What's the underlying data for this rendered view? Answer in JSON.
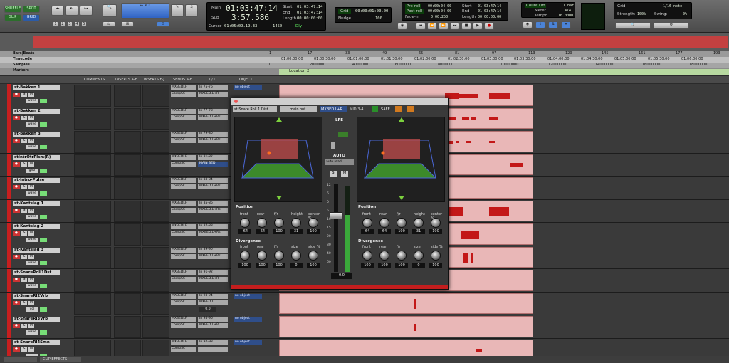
{
  "toolbar": {
    "modes": [
      "SHUFFLE",
      "SPOT",
      "SLIP",
      "GRID"
    ],
    "number_buttons": [
      "1",
      "2",
      "3",
      "4",
      "5"
    ],
    "counter": {
      "main_label": "Main",
      "main_value": "01:03:47:14",
      "sub_label": "Sub",
      "sub_value": "3:57.586",
      "start_label": "Start",
      "start_value": "01:03:47:14",
      "end_label": "End",
      "end_value": "01:03:47:14",
      "length_label": "Length",
      "length_value": "00:00:00:00",
      "cursor_label": "Cursor",
      "cursor_value": "01:05:09.19.33",
      "cursor_extra": "1450",
      "dly_label": "Dly"
    },
    "grid": {
      "grid_label": "Grid",
      "grid_value": "00:00:01:00.00",
      "nudge_label": "Nudge",
      "nudge_value": "100"
    },
    "preroll": {
      "preroll_label": "Pre-roll",
      "preroll_value": "00:00:04:00",
      "postroll_label": "Post-roll",
      "postroll_value": "00:00:04:00",
      "fadein_label": "Fade-in",
      "fadein_value": "0:00.250",
      "start_label": "Start",
      "start_value": "01:03:47:14",
      "end_label": "End",
      "end_value": "01:03:47:14",
      "length_label": "Length",
      "length_value": "00:00:00:00"
    },
    "meter": {
      "countoff": "Count Off",
      "countoff_value": "1 bar",
      "meter_label": "Meter",
      "meter_value": "4/4",
      "tempo_label": "Tempo",
      "tempo_value": "116.0000"
    },
    "grid2": {
      "grid_label": "Grid:",
      "grid_value": "1/16 note",
      "strength_label": "Strength:",
      "strength_value": "100%",
      "swing_label": "Swing:",
      "swing_value": "0%"
    }
  },
  "rulers": [
    {
      "name": "Bars|Beats",
      "ticks": [
        "1",
        "17",
        "33",
        "49",
        "65",
        "81",
        "97",
        "113",
        "129",
        "145",
        "161",
        "177",
        "193"
      ]
    },
    {
      "name": "Timecode",
      "ticks": [
        "01:00:00:00",
        "01:00:30:00",
        "01:01:00:00",
        "01:01:30:00",
        "01:02:00:00",
        "01:02:30:00",
        "01:03:00:00",
        "01:03:30:00",
        "01:04:00:00",
        "01:04:30:00",
        "01:05:00:00",
        "01:05:30:00",
        "01:06:00:00"
      ]
    },
    {
      "name": "Samples",
      "ticks": [
        "0",
        "2000000",
        "4000000",
        "6000000",
        "8000000",
        "10000000",
        "12000000",
        "14000000",
        "16000000",
        "18000000"
      ]
    },
    {
      "name": "Markers",
      "ticks": []
    }
  ],
  "marker": {
    "label": "Location 2"
  },
  "columns": [
    "COMMENTS",
    "INSERTS A-E",
    "INSERTS F-J",
    "SENDS A-E",
    "I / O",
    "OBJECT"
  ],
  "tracks": [
    {
      "name": "st-Bakken 1",
      "send": "MXBEDLF",
      "send2": "CompSC",
      "in": "In 75-76",
      "out": "MXBED.L+R",
      "view": "wave",
      "obj": "no object"
    },
    {
      "name": "st-Bakken 2",
      "send": "MXBEDLF",
      "send2": "CompSC",
      "in": "In 77-78",
      "out": "MXBED.L+Rs",
      "view": "wave",
      "obj": "no object"
    },
    {
      "name": "st-Bakken 3",
      "send": "MXBEDLF",
      "send2": "CompSC",
      "in": "In 79-80",
      "out": "MXBED.L+Rs",
      "view": "wave",
      "obj": "no object"
    },
    {
      "name": "stIntrOtrPlsm(R)",
      "send": "MXBEDLF",
      "send2": "CompSC",
      "in": "In 81-82",
      "out": "MAIN BED",
      "view": "fghtn",
      "obj": "no object"
    },
    {
      "name": "st-Intro-Pulse",
      "send": "MXBEDLF",
      "send2": "CompSC",
      "in": "In 83-84",
      "out": "MXBED.L+Rs",
      "view": "wave",
      "obj": "no object"
    },
    {
      "name": "st-Kantslag 1",
      "send": "MXBEDLF",
      "send2": "CompSC",
      "in": "In 85-86",
      "out": "MXBED.L+Rs",
      "view": "wave",
      "obj": "no object"
    },
    {
      "name": "st-Kantslag 2",
      "send": "MXBEDLF",
      "send2": "CompSC",
      "in": "In 87-88",
      "out": "MXBED.L+Rs",
      "view": "wave",
      "obj": "no object"
    },
    {
      "name": "st-Kantslag 3",
      "send": "MXBEDLF",
      "send2": "CompSC",
      "in": "In 89-90",
      "out": "MXBED.L+Rs",
      "view": "wave",
      "obj": "no object"
    },
    {
      "name": "st-SnareRoll1Dst",
      "send": "MXBEDLF",
      "send2": "CompSC",
      "in": "In 91-92",
      "out": "MXBED.L+R",
      "view": "wave",
      "obj": "no object"
    },
    {
      "name": "st-SnareRl2Vrb",
      "send": "MXBEDLF",
      "send2": "CompSC",
      "in": "In 93-94",
      "out": "MXBED.C",
      "view": "vol",
      "obj": "no object",
      "vol": "0.0"
    },
    {
      "name": "st-SnareRl3Vrb",
      "send": "MXBEDLF",
      "send2": "CompSC",
      "in": "In 95-96",
      "out": "MXBED.L+R",
      "view": "wave",
      "obj": "no object"
    },
    {
      "name": "st-SnareRl4Smn",
      "send": "MXBEDLF",
      "send2": "CompSC",
      "in": "In 97-98",
      "out": "",
      "view": "",
      "obj": "no object"
    }
  ],
  "plugin": {
    "track_label": "st-Snare Roll 1 Dist",
    "preset": "main out",
    "output": "MXBED.L+R",
    "midi": "MID 3-4",
    "safe": "SAFE",
    "lfe_label": "LFE",
    "auto_label": "AUTO",
    "auto_mode": "auto read",
    "solo": "S",
    "mute": "M",
    "fader_value": "0.0",
    "fader_scale": [
      "12",
      "6",
      "0",
      "5",
      "10",
      "15",
      "20",
      "30",
      "40",
      "60"
    ],
    "left": {
      "position_label": "Position",
      "divergence_label": "Divergence",
      "pos_labels": [
        "front",
        "rear",
        "f/r",
        "height",
        "center %"
      ],
      "pos_values": [
        "-64",
        "-64",
        "100",
        "31",
        "100"
      ],
      "div_labels": [
        "front",
        "rear",
        "f/r",
        "size",
        "side %"
      ],
      "div_values": [
        "100",
        "100",
        "100",
        "0",
        "100"
      ]
    },
    "right": {
      "position_label": "Position",
      "divergence_label": "Divergence",
      "pos_labels": [
        "front",
        "rear",
        "f/r",
        "height",
        "center %"
      ],
      "pos_values": [
        "64",
        "64",
        "100",
        "31",
        "100"
      ],
      "div_labels": [
        "front",
        "rear",
        "f/r",
        "size",
        "side %"
      ],
      "div_values": [
        "100",
        "100",
        "100",
        "0",
        "100"
      ]
    }
  },
  "bottom_tabs": [
    "CLIP EFFECTS"
  ],
  "colors": {
    "track_red": "#c71f1f",
    "clip_bg": "#e9b7b7",
    "waveform": "#c31818",
    "object_blue": "#2f4e8a"
  }
}
